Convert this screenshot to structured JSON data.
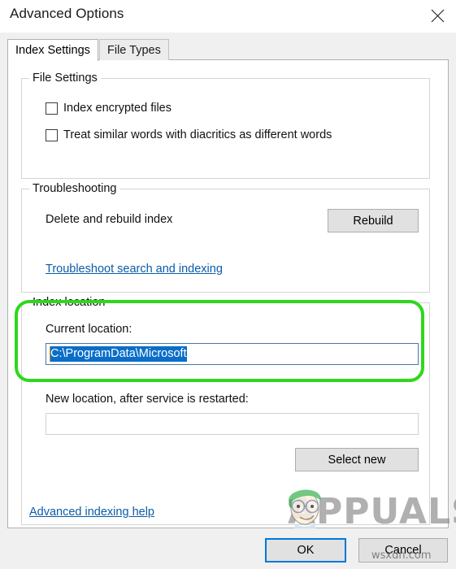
{
  "window": {
    "title": "Advanced Options",
    "close_icon": "close-x-icon"
  },
  "tabs": [
    {
      "label": "Index Settings",
      "active": true
    },
    {
      "label": "File Types",
      "active": false
    }
  ],
  "groups": {
    "file_settings": {
      "legend": "File Settings",
      "checkboxes": [
        {
          "label": "Index encrypted files",
          "checked": false
        },
        {
          "label": "Treat similar words with diacritics as different words",
          "checked": false
        }
      ]
    },
    "troubleshooting": {
      "legend": "Troubleshooting",
      "rebuild_label": "Delete and rebuild index",
      "rebuild_button": "Rebuild",
      "troubleshoot_link": "Troubleshoot search and indexing"
    },
    "index_location": {
      "legend": "Index location",
      "current_location_label": "Current location:",
      "current_location_value": "C:\\ProgramData\\Microsoft",
      "new_location_label": "New location, after service is restarted:",
      "new_location_value": "",
      "select_new_button": "Select new"
    }
  },
  "advanced_indexing_link": "Advanced indexing help",
  "footer": {
    "ok_label": "OK",
    "cancel_label": "Cancel"
  },
  "annotation": {
    "type": "rounded-rect-highlight",
    "color": "#2fd71b",
    "target": "Index location"
  },
  "watermarks": {
    "appuals": "APPUALS",
    "site": "wsxdn.com"
  },
  "colors": {
    "accent": "#0078d7",
    "selection": "#0a6ec9",
    "link": "#0a5ca8",
    "button_face": "#e1e1e1",
    "annotation_green": "#2fd71b"
  }
}
